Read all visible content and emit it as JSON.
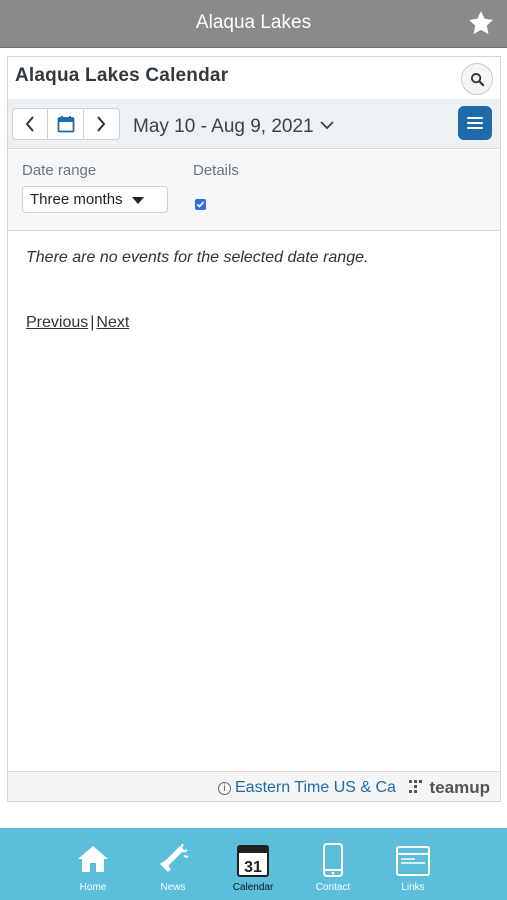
{
  "app": {
    "title": "Alaqua Lakes"
  },
  "calendar": {
    "title": "Alaqua Lakes Calendar",
    "date_range": "May 10 - Aug 9, 2021",
    "filters": {
      "date_range_label": "Date range",
      "date_range_value": "Three months",
      "details_label": "Details",
      "details_checked": true
    },
    "empty_message": "There are no events for the selected date range.",
    "pager": {
      "previous": "Previous",
      "separator": "|",
      "next": "Next"
    },
    "footer": {
      "timezone": "Eastern Time US & Ca",
      "brand": "teamup"
    }
  },
  "tabs": [
    {
      "label": "Home",
      "icon": "home-icon"
    },
    {
      "label": "News",
      "icon": "megaphone-icon"
    },
    {
      "label": "Calendar",
      "icon": "calendar-31-icon",
      "day": "31",
      "active": true
    },
    {
      "label": "Contact",
      "icon": "phone-icon"
    },
    {
      "label": "Links",
      "icon": "browser-window-icon"
    }
  ],
  "colors": {
    "topbar": "#8a8a8a",
    "tabbar": "#5bbfdc",
    "accent": "#1f6aa8"
  }
}
